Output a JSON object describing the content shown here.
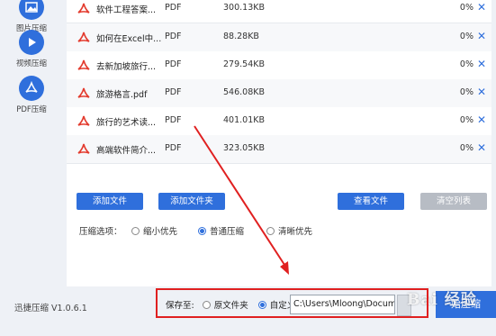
{
  "sidebar": {
    "items": [
      {
        "label": "图片压缩",
        "icon": "image-icon"
      },
      {
        "label": "视频压缩",
        "icon": "play-icon"
      },
      {
        "label": "PDF压缩",
        "icon": "pdf-acrobat-icon"
      }
    ]
  },
  "files": [
    {
      "name": "软件工程答案...",
      "type": "PDF",
      "size": "300.13KB",
      "progress": "0%"
    },
    {
      "name": "如何在Excel中...",
      "type": "PDF",
      "size": "88.28KB",
      "progress": "0%"
    },
    {
      "name": "去新加坡旅行...",
      "type": "PDF",
      "size": "279.54KB",
      "progress": "0%"
    },
    {
      "name": "旅游格言.pdf",
      "type": "PDF",
      "size": "546.08KB",
      "progress": "0%"
    },
    {
      "name": "旅行的艺术读...",
      "type": "PDF",
      "size": "401.01KB",
      "progress": "0%"
    },
    {
      "name": "高端软件简介...",
      "type": "PDF",
      "size": "323.05KB",
      "progress": "0%"
    }
  ],
  "toolbar": {
    "add_file": "添加文件",
    "add_folder": "添加文件夹",
    "view_files": "查看文件",
    "clear_list": "清空列表"
  },
  "options": {
    "label": "压缩选项：",
    "choices": [
      "缩小优先",
      "普通压缩",
      "清晰优先"
    ],
    "selected": "普通压缩"
  },
  "footer": {
    "version": "迅捷压缩 V1.0.6.1",
    "save_to": "保存至:",
    "original_folder": "原文件夹",
    "custom": "自定义",
    "path": "C:\\Users\\Mloong\\Docum",
    "start_button": "始压缩",
    "watermark": "Bai 经验"
  },
  "colors": {
    "accent": "#2f6fdc",
    "pdf_red": "#e33b2e",
    "highlight_red": "#e02020"
  }
}
